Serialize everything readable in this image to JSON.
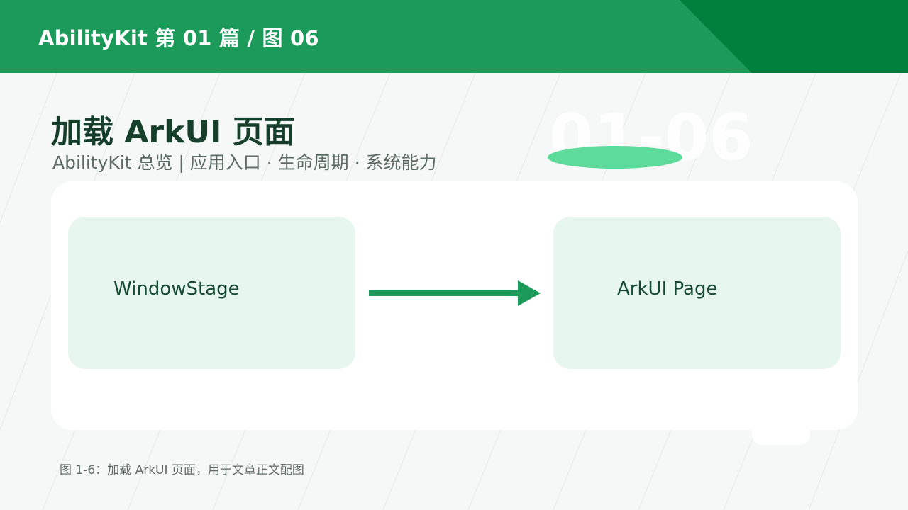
{
  "header": {
    "title": "AbilityKit 第 01 篇 / 图 06"
  },
  "watermark": {
    "number": "01-06"
  },
  "page": {
    "title": "加载 ArkUI 页面",
    "subtitle": "AbilityKit 总览 | 应用入口 · 生命周期 · 系统能力"
  },
  "diagram": {
    "nodes": [
      {
        "id": "windowstage",
        "label": "WindowStage"
      },
      {
        "id": "arkui-page",
        "label": "ArkUI Page"
      }
    ],
    "edges": [
      {
        "from": "windowstage",
        "to": "arkui-page",
        "label": ""
      }
    ]
  },
  "caption": "图 1-6：加载 ArkUI 页面，用于文章正文配图",
  "colors": {
    "header": "#1b9a59",
    "header_accent": "#007e3c",
    "node_fill": "#e7f6ee",
    "arrow": "#1b9a59",
    "title_text": "#153f2b",
    "watermark_ellipse": "#5ddb9b"
  }
}
